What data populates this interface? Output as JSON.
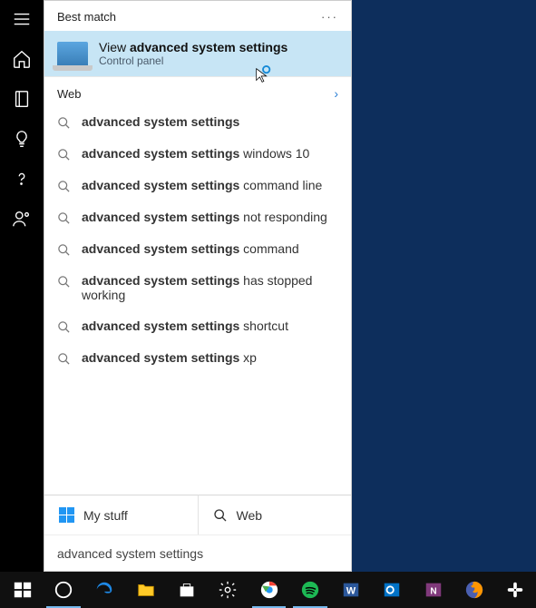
{
  "rail": {
    "tooltips": [
      "Menu",
      "Home",
      "Notebook",
      "Bulb",
      "Help",
      "Account"
    ]
  },
  "sections": {
    "best_match": "Best match",
    "web": "Web"
  },
  "best_match": {
    "prefix": "View ",
    "bold": "advanced system settings",
    "subtitle": "Control panel"
  },
  "suggestions": [
    {
      "bold": "advanced system settings",
      "rest": ""
    },
    {
      "bold": "advanced system settings",
      "rest": " windows 10"
    },
    {
      "bold": "advanced system settings",
      "rest": " command line"
    },
    {
      "bold": "advanced system settings",
      "rest": " not responding"
    },
    {
      "bold": "advanced system settings",
      "rest": " command"
    },
    {
      "bold": "advanced system settings",
      "rest": " has stopped working"
    },
    {
      "bold": "advanced system settings",
      "rest": " shortcut"
    },
    {
      "bold": "advanced system settings",
      "rest": " xp"
    }
  ],
  "tabs": {
    "my_stuff": "My stuff",
    "web": "Web"
  },
  "search_value": "advanced system settings",
  "taskbar": [
    "start",
    "cortana",
    "edge",
    "file-explorer",
    "store",
    "settings",
    "chrome",
    "spotify",
    "word",
    "outlook",
    "onenote",
    "firefox",
    "slack"
  ]
}
